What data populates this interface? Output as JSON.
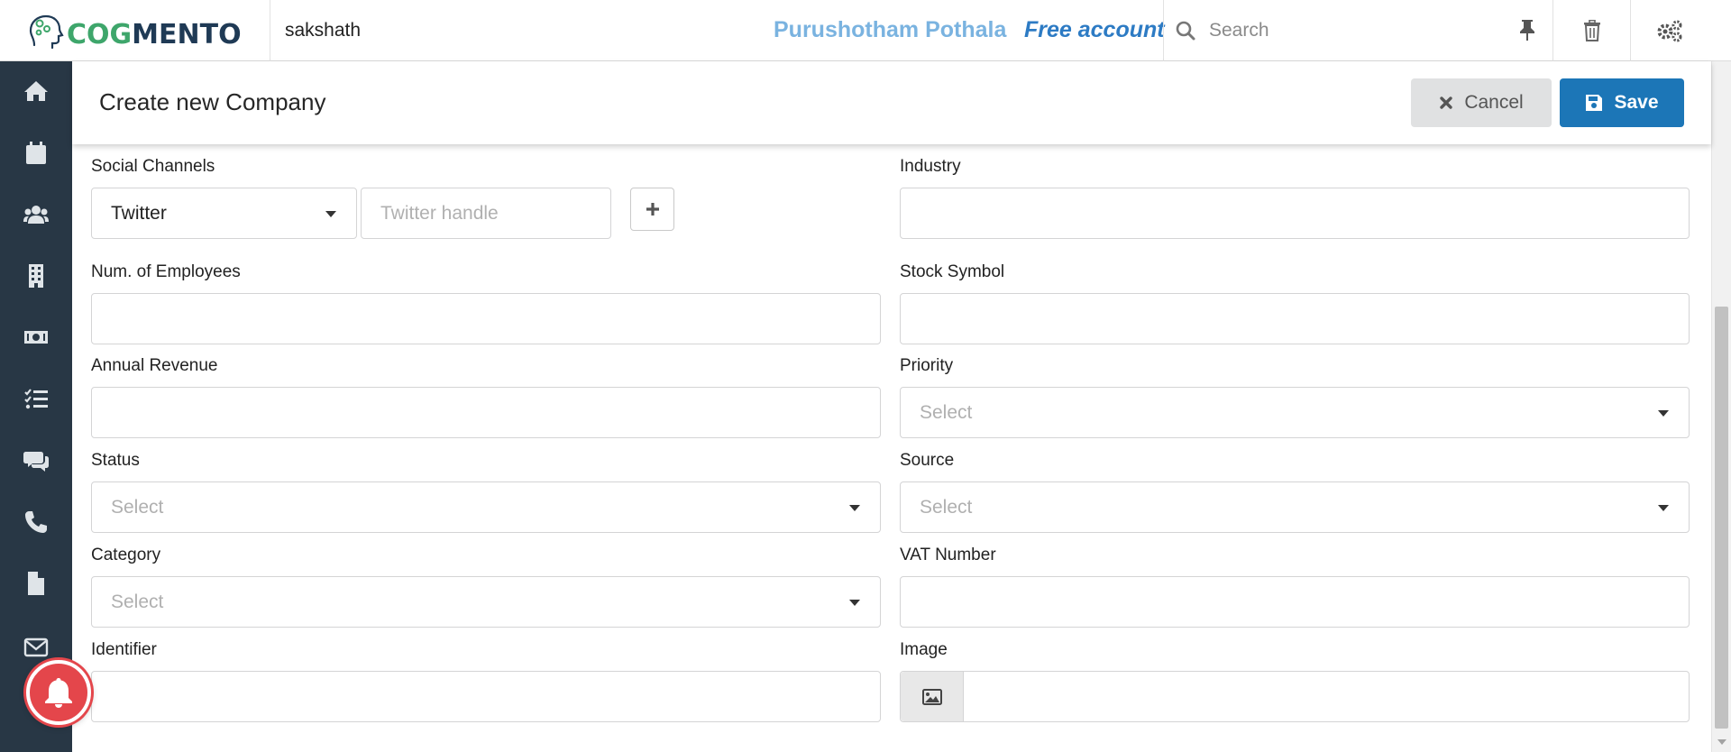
{
  "app": {
    "logo_text_cog": "COG",
    "logo_text_mento": "MENTO",
    "current_user_short": "sakshath",
    "user_name": "Purushotham Pothala",
    "account_type": "Free account",
    "search_placeholder": "Search"
  },
  "header": {
    "title": "Create new Company",
    "cancel_label": "Cancel",
    "save_label": "Save"
  },
  "sidebar": {
    "items": [
      "home-icon",
      "calendar-icon",
      "contacts-icon",
      "companies-icon",
      "deals-icon",
      "tasks-icon",
      "cases-icon",
      "calls-icon",
      "documents-icon",
      "email-icon"
    ]
  },
  "form": {
    "social_channels": {
      "label": "Social Channels",
      "channel_value": "Twitter",
      "handle_placeholder": "Twitter handle"
    },
    "industry": {
      "label": "Industry",
      "value": ""
    },
    "num_employees": {
      "label": "Num. of Employees",
      "value": ""
    },
    "stock_symbol": {
      "label": "Stock Symbol",
      "value": ""
    },
    "annual_revenue": {
      "label": "Annual Revenue",
      "value": ""
    },
    "priority": {
      "label": "Priority",
      "placeholder": "Select"
    },
    "status": {
      "label": "Status",
      "placeholder": "Select"
    },
    "source": {
      "label": "Source",
      "placeholder": "Select"
    },
    "category": {
      "label": "Category",
      "placeholder": "Select"
    },
    "vat_number": {
      "label": "VAT Number",
      "value": ""
    },
    "identifier": {
      "label": "Identifier",
      "value": ""
    },
    "image": {
      "label": "Image",
      "value": ""
    }
  },
  "colors": {
    "sidebar_bg": "#283745",
    "save_button": "#1c76b7",
    "cancel_button": "#e0e1e2",
    "user_name": "#7ab3e0",
    "account": "#2d7bc4",
    "logo_green": "#3ea66b",
    "logo_navy": "#1f3a55",
    "notification": "#e4464b"
  }
}
